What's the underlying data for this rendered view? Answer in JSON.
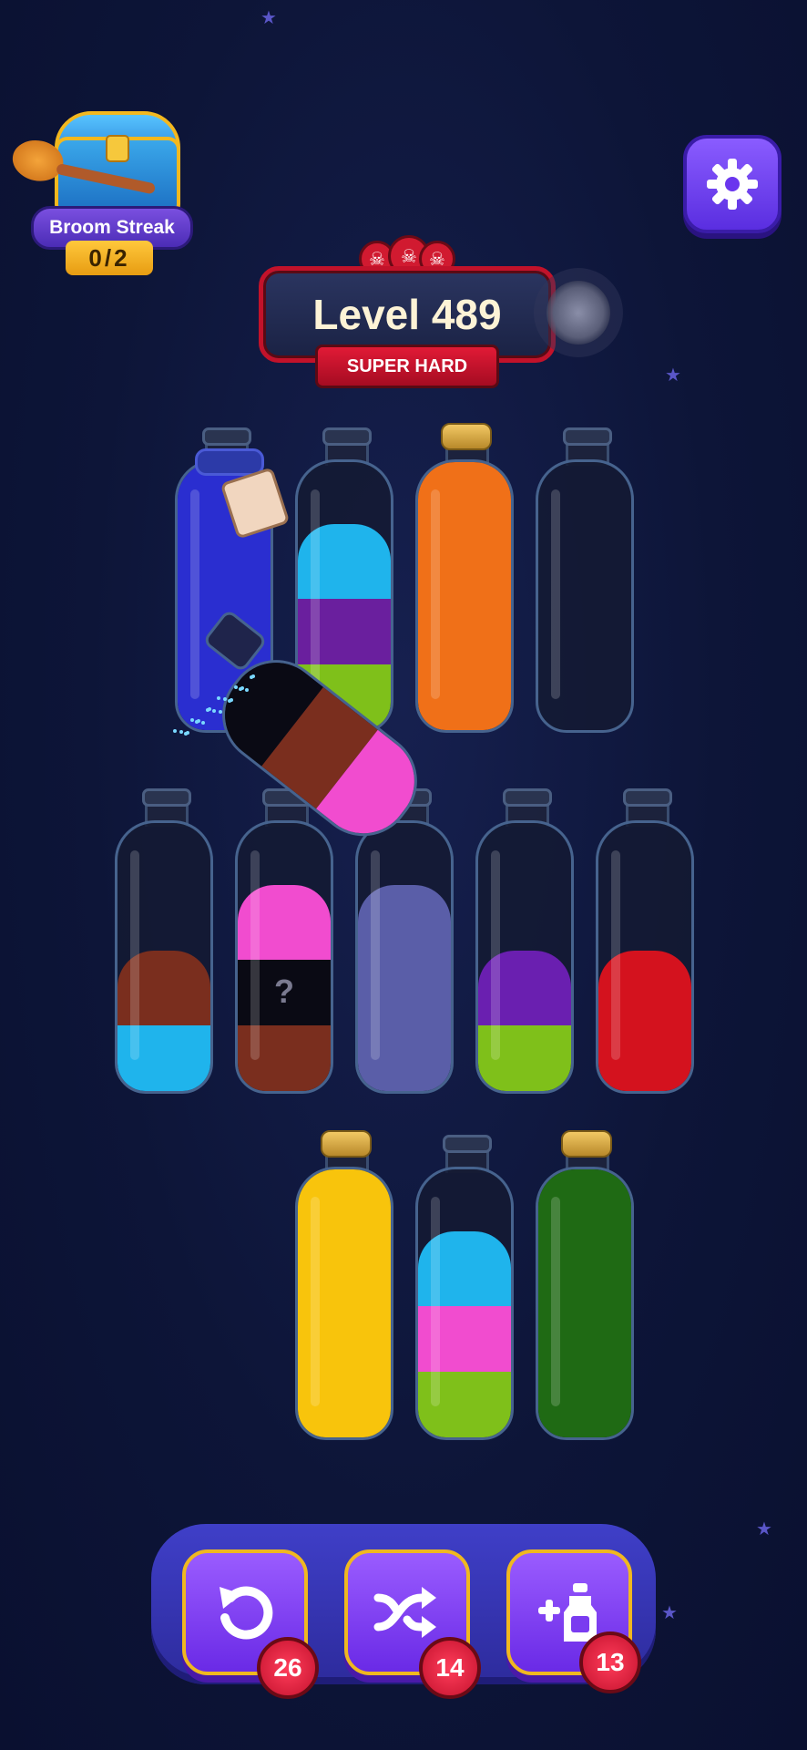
{
  "streak": {
    "title": "Broom Streak",
    "progress": "0/2"
  },
  "level": {
    "label": "Level 489",
    "difficulty": "SUPER HARD",
    "skulls": 3
  },
  "icons": {
    "settings": "gear-icon",
    "undo": "undo-icon",
    "shuffle": "shuffle-icon",
    "add_bottle": "add-bottle-icon",
    "skull": "skull-icon",
    "star": "star-icon"
  },
  "bottles": [
    {
      "row": 1,
      "corked": false,
      "tag": true,
      "layers": [
        "#2a2ed0",
        "#2a2ed0",
        "#2a2ed0",
        "#2a2ed0"
      ]
    },
    {
      "row": 1,
      "corked": false,
      "layers": [
        "#1fb4ec",
        "#6a1f9e",
        "#7fc01a"
      ]
    },
    {
      "row": 1,
      "corked": true,
      "layers": [
        "#f07018",
        "#f07018",
        "#f07018",
        "#f07018"
      ]
    },
    {
      "row": 1,
      "corked": false,
      "layers": []
    },
    {
      "row": 2,
      "corked": false,
      "layers": [
        "#7a2e1e",
        "#1fb4ec"
      ]
    },
    {
      "row": 2,
      "corked": false,
      "layers": [
        "#f14ccf",
        "#0a0a14",
        "#7a2e1e"
      ],
      "hidden_layer": "?"
    },
    {
      "row": 2,
      "corked": false,
      "layers": [
        "#5a5ea8",
        "#5a5ea8",
        "#5a5ea8"
      ]
    },
    {
      "row": 2,
      "corked": false,
      "layers": [
        "#6a1fb0",
        "#7fc01a"
      ]
    },
    {
      "row": 2,
      "corked": false,
      "layers": [
        "#d4121e",
        "#d4121e"
      ]
    },
    {
      "row": 3,
      "corked": true,
      "layers": [
        "#f8c40c",
        "#f8c40c",
        "#f8c40c",
        "#f8c40c"
      ]
    },
    {
      "row": 3,
      "corked": false,
      "layers": [
        "#1fb4ec",
        "#f14ccf",
        "#7fc01a"
      ]
    },
    {
      "row": 3,
      "corked": true,
      "layers": [
        "#1f6a14",
        "#1f6a14",
        "#1f6a14",
        "#1f6a14"
      ]
    }
  ],
  "pouring_bottle": {
    "layers": [
      "#0a0a14",
      "#7a2e1e",
      "#f14ccf"
    ]
  },
  "boosters": [
    {
      "name": "undo",
      "count": "26"
    },
    {
      "name": "shuffle",
      "count": "14"
    },
    {
      "name": "add-bottle",
      "count": "13"
    }
  ]
}
